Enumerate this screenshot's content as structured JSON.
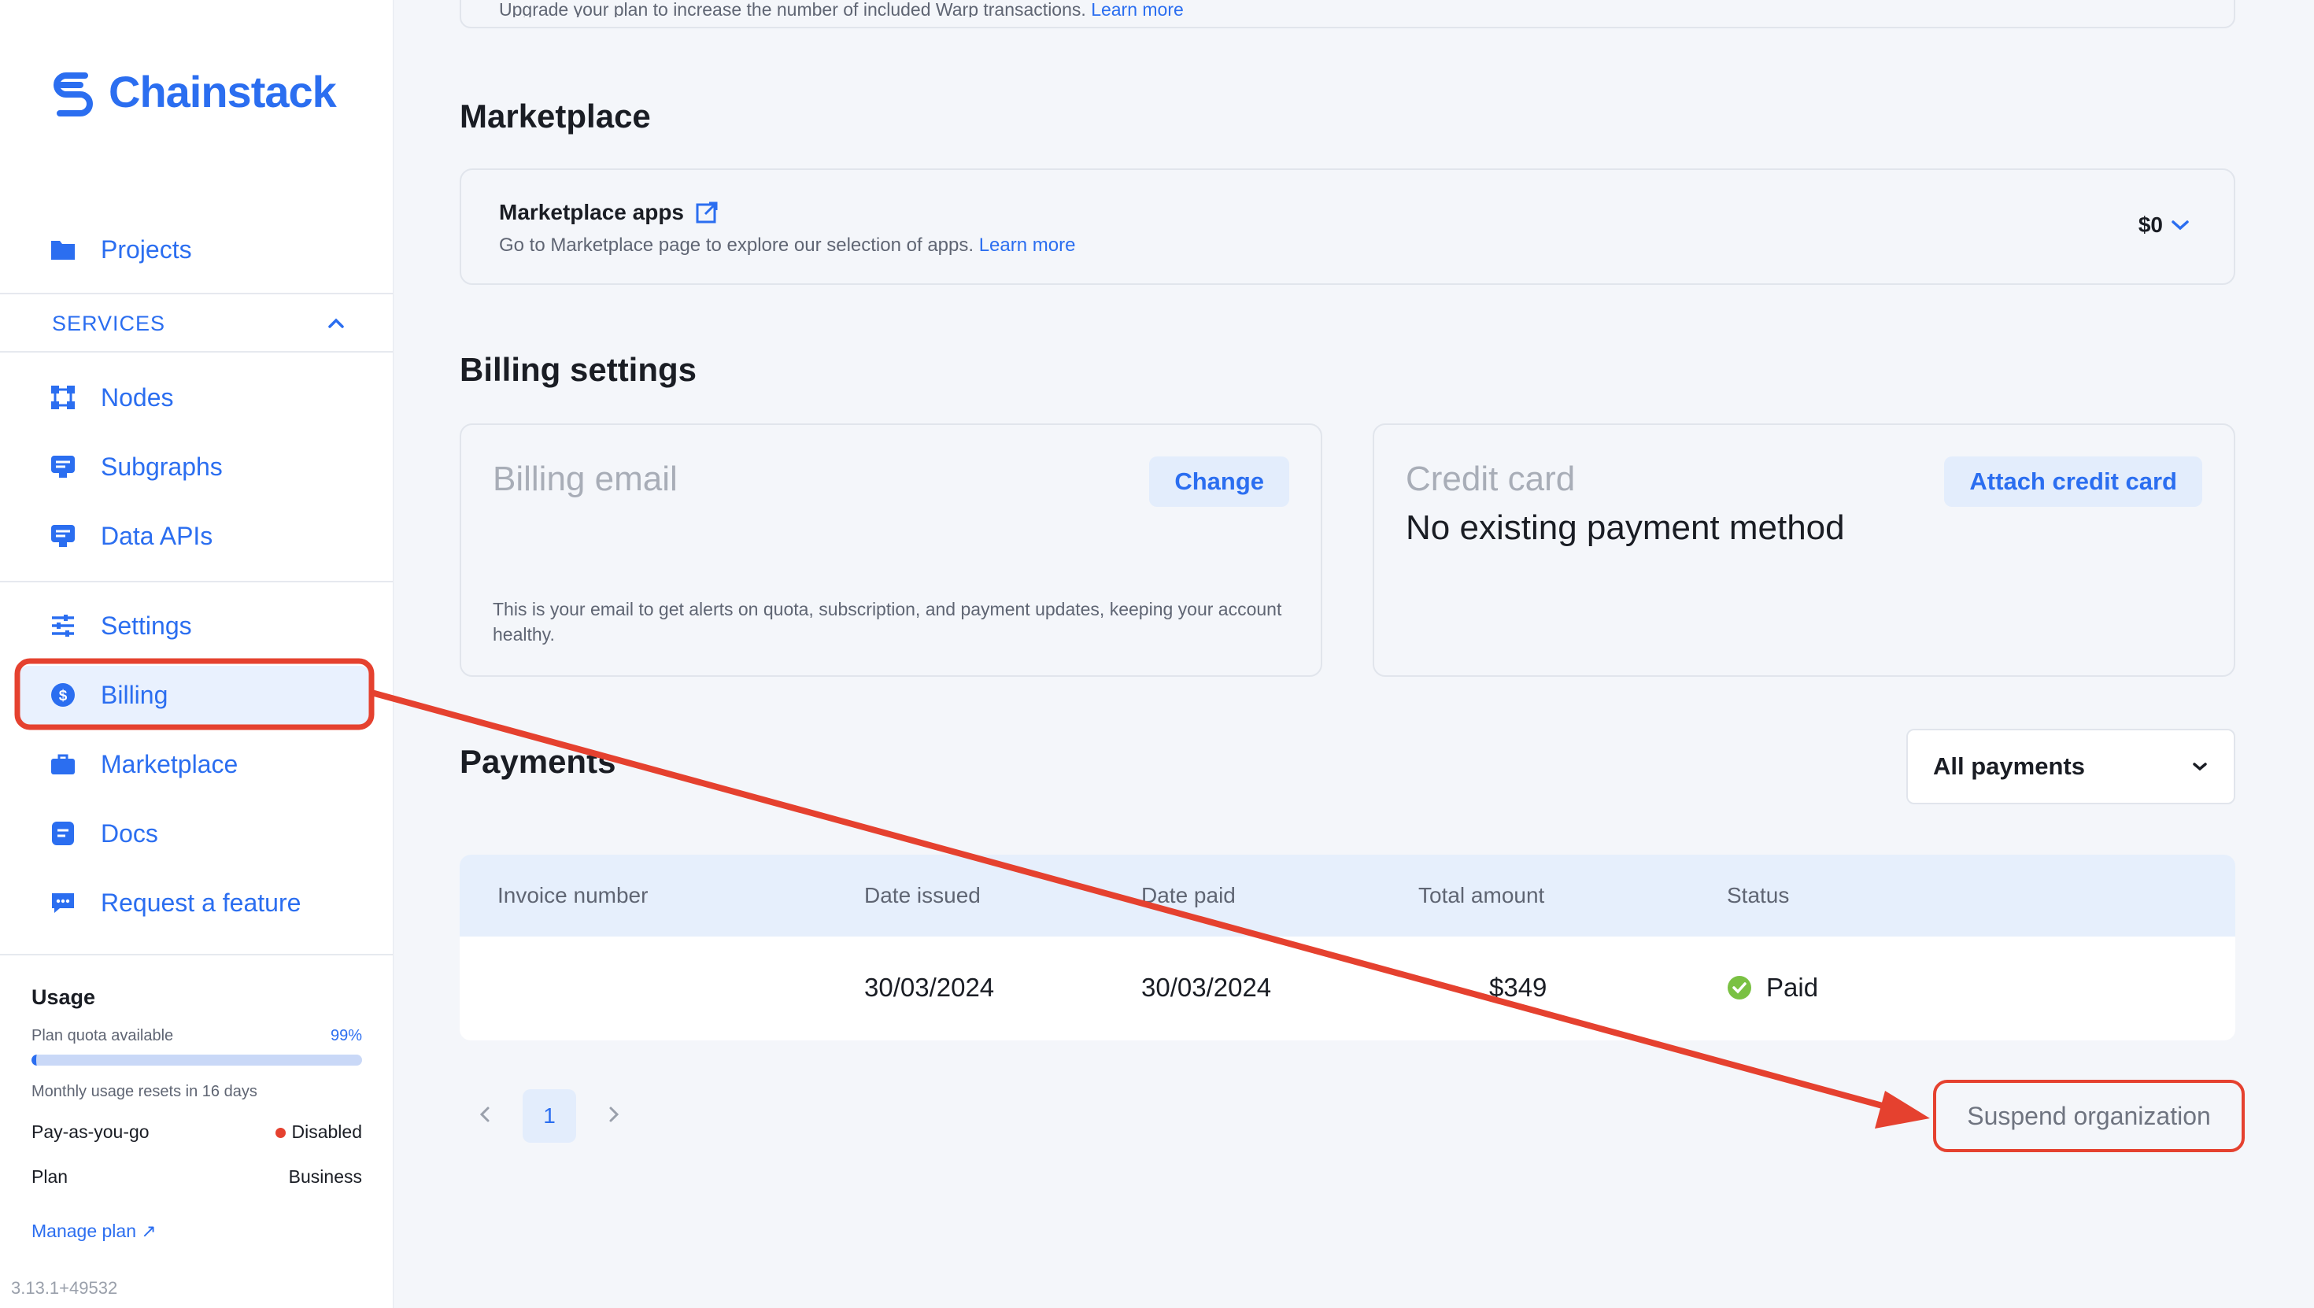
{
  "brand": {
    "name": "Chainstack",
    "accent": "#2b6ef0"
  },
  "sidebar": {
    "projects_label": "Projects",
    "services_label": "SERVICES",
    "items": [
      {
        "label": "Nodes",
        "icon": "nodes-icon"
      },
      {
        "label": "Subgraphs",
        "icon": "subgraphs-icon"
      },
      {
        "label": "Data APIs",
        "icon": "data-apis-icon"
      },
      {
        "label": "Settings",
        "icon": "settings-icon"
      },
      {
        "label": "Billing",
        "icon": "billing-icon"
      },
      {
        "label": "Marketplace",
        "icon": "marketplace-icon"
      },
      {
        "label": "Docs",
        "icon": "docs-icon"
      },
      {
        "label": "Request a feature",
        "icon": "request-feature-icon"
      }
    ],
    "usage": {
      "title": "Usage",
      "quota_label": "Plan quota available",
      "quota_percent": "99%",
      "reset_text": "Monthly usage resets in 16 days",
      "payg_label": "Pay-as-you-go",
      "payg_value": "Disabled",
      "plan_label": "Plan",
      "plan_value": "Business",
      "manage_plan": "Manage plan ↗"
    },
    "version": "3.13.1+49532"
  },
  "main": {
    "top_card_text": "Upgrade your plan to increase the number of included Warp transactions.",
    "top_card_link": "Learn more",
    "marketplace": {
      "title": "Marketplace",
      "card_title": "Marketplace apps",
      "card_desc": "Go to Marketplace page to explore our selection of apps.",
      "card_link": "Learn more",
      "price": "$0"
    },
    "billing_settings": {
      "title": "Billing settings",
      "email_label": "Billing email",
      "change_button": "Change",
      "email_help": "This is your email to get alerts on quota, subscription, and payment updates, keeping your account healthy.",
      "card_label": "Credit card",
      "attach_button": "Attach credit card",
      "no_method": "No existing payment method"
    },
    "payments": {
      "title": "Payments",
      "filter": "All payments",
      "columns": [
        "Invoice number",
        "Date issued",
        "Date paid",
        "Total amount",
        "Status"
      ],
      "rows": [
        {
          "invoice": "",
          "date_issued": "30/03/2024",
          "date_paid": "30/03/2024",
          "total": "$349",
          "status": "Paid"
        }
      ],
      "current_page": "1"
    },
    "suspend_button": "Suspend organization"
  },
  "annotation_color": "#e5412f"
}
